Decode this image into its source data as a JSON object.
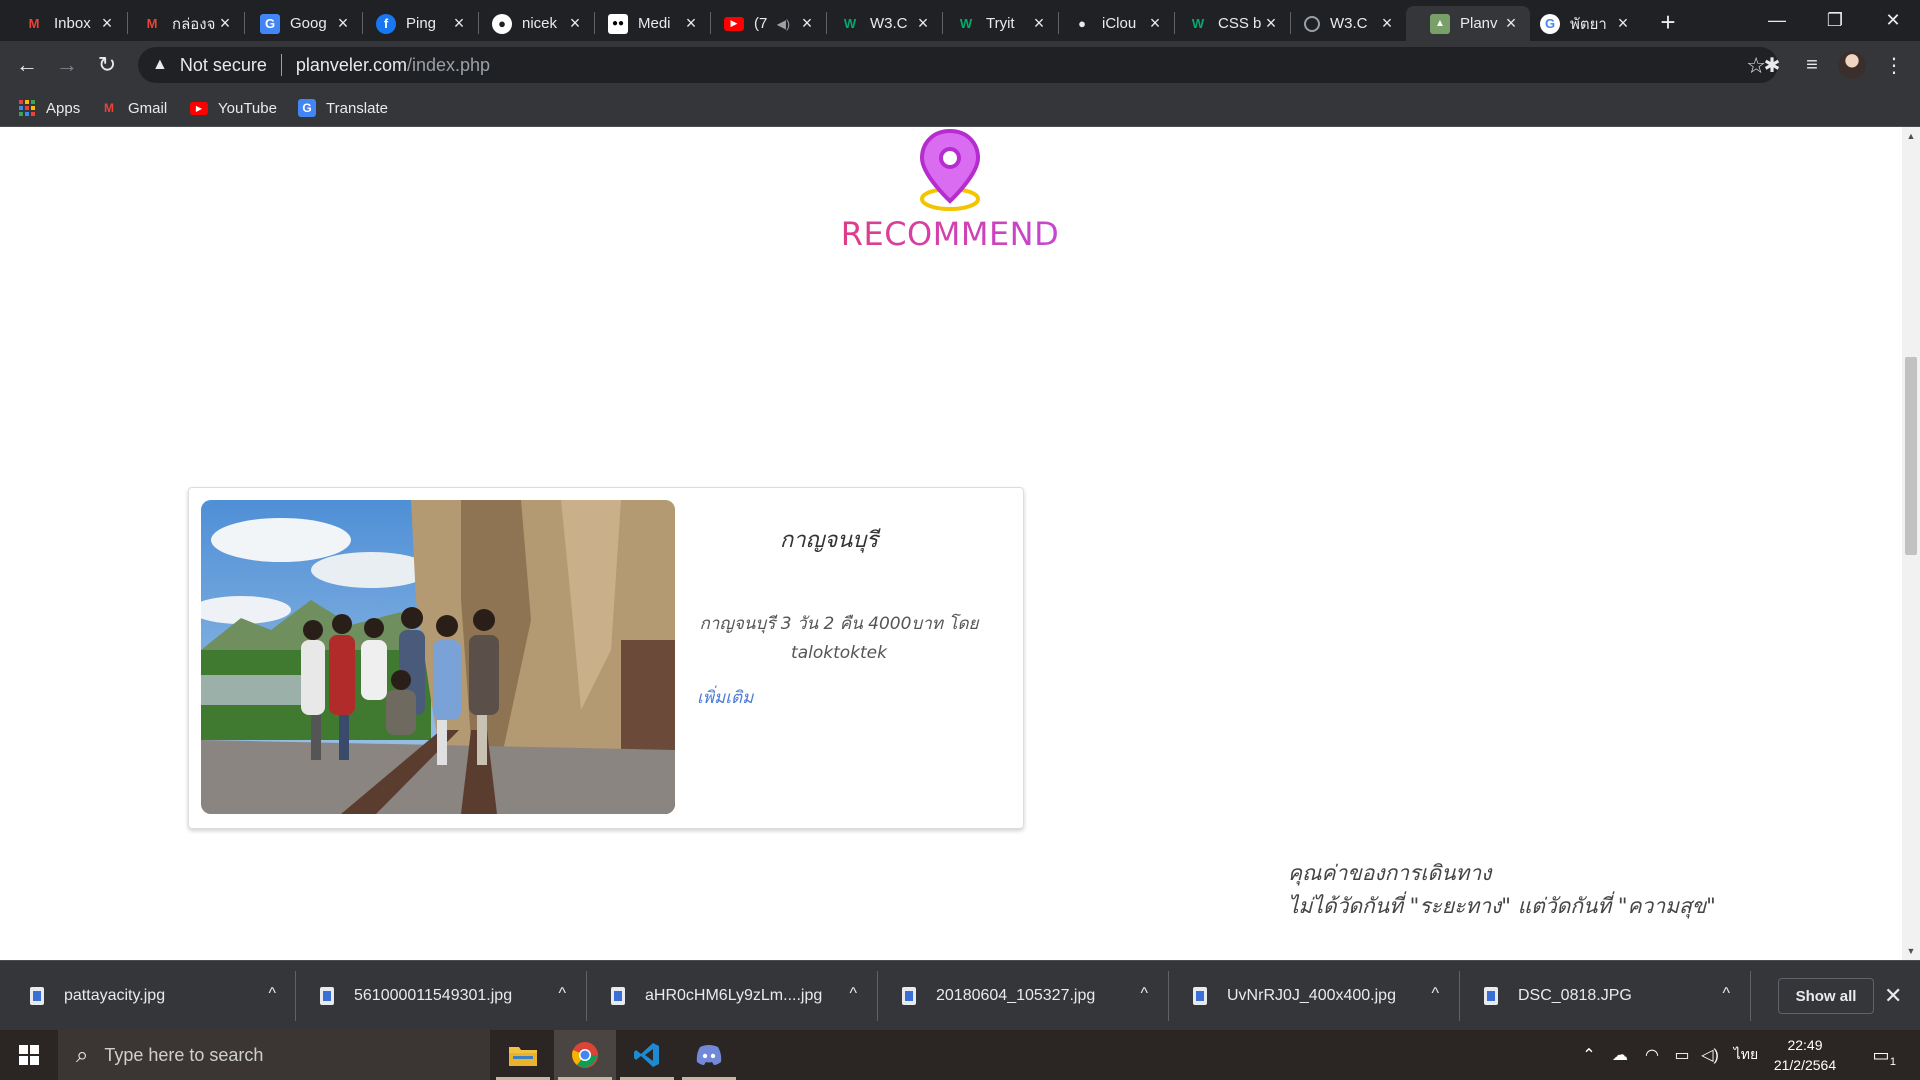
{
  "browser": {
    "tabs": [
      {
        "title": "Inbox",
        "icon": "gmail-icon"
      },
      {
        "title": "กล่องจ",
        "icon": "gmail-icon"
      },
      {
        "title": "Goog",
        "icon": "google-translate-icon"
      },
      {
        "title": "Ping",
        "icon": "facebook-icon"
      },
      {
        "title": "nicek",
        "icon": "github-icon"
      },
      {
        "title": "Medi",
        "icon": "medium-icon"
      },
      {
        "title": "(7",
        "icon": "youtube-icon"
      },
      {
        "title": "W3.C",
        "icon": "w3schools-icon"
      },
      {
        "title": "Tryit",
        "icon": "w3schools-icon"
      },
      {
        "title": "iClou",
        "icon": "apple-icon"
      },
      {
        "title": "CSS b",
        "icon": "w3schools-icon"
      },
      {
        "title": "W3.C",
        "icon": "globe-icon"
      },
      {
        "title": "Planv",
        "icon": "planveler-icon"
      },
      {
        "title": "พัตยา",
        "icon": "google-icon"
      }
    ],
    "active_tab_index": 12,
    "address": {
      "security_label": "Not secure",
      "host": "planveler.com",
      "path": "/index.php"
    },
    "bookmarks": [
      {
        "label": "Apps",
        "icon": "apps-grid-icon"
      },
      {
        "label": "Gmail",
        "icon": "gmail-icon"
      },
      {
        "label": "YouTube",
        "icon": "youtube-icon"
      },
      {
        "label": "Translate",
        "icon": "google-translate-icon"
      }
    ]
  },
  "page": {
    "section_title": "RECOMMEND",
    "section_icon": "map-pin-icon",
    "card": {
      "title": "กาญจนบุรี",
      "description": "กาญจนบุรี 3 วัน 2 คืน 4000บาท โดย taloktoktek",
      "more_link": "เพิ่มเติม"
    },
    "quote": {
      "line1": "คุณค่าของการเดินทาง",
      "line2": "ไม่ได้วัดกันที่ \"ระยะทาง\" แต่วัดกันที่ \"ความสุข\""
    }
  },
  "downloads": {
    "files": [
      "pattayacity.jpg",
      "561000011549301.jpg",
      "aHR0cHM6Ly9zLm....jpg",
      "20180604_105327.jpg",
      "UvNrRJ0J_400x400.jpg",
      "DSC_0818.JPG"
    ],
    "show_all_label": "Show all"
  },
  "taskbar": {
    "search_placeholder": "Type here to search",
    "language": "ไทย",
    "time": "22:49",
    "date": "21/2/2564",
    "notification_count": "1"
  },
  "colors": {
    "recommend_gradient_start": "#e43a7a",
    "recommend_gradient_end": "#c048e0",
    "link": "#4a7bd6",
    "chrome_dark": "#202124",
    "chrome_toolbar": "#35363a"
  }
}
